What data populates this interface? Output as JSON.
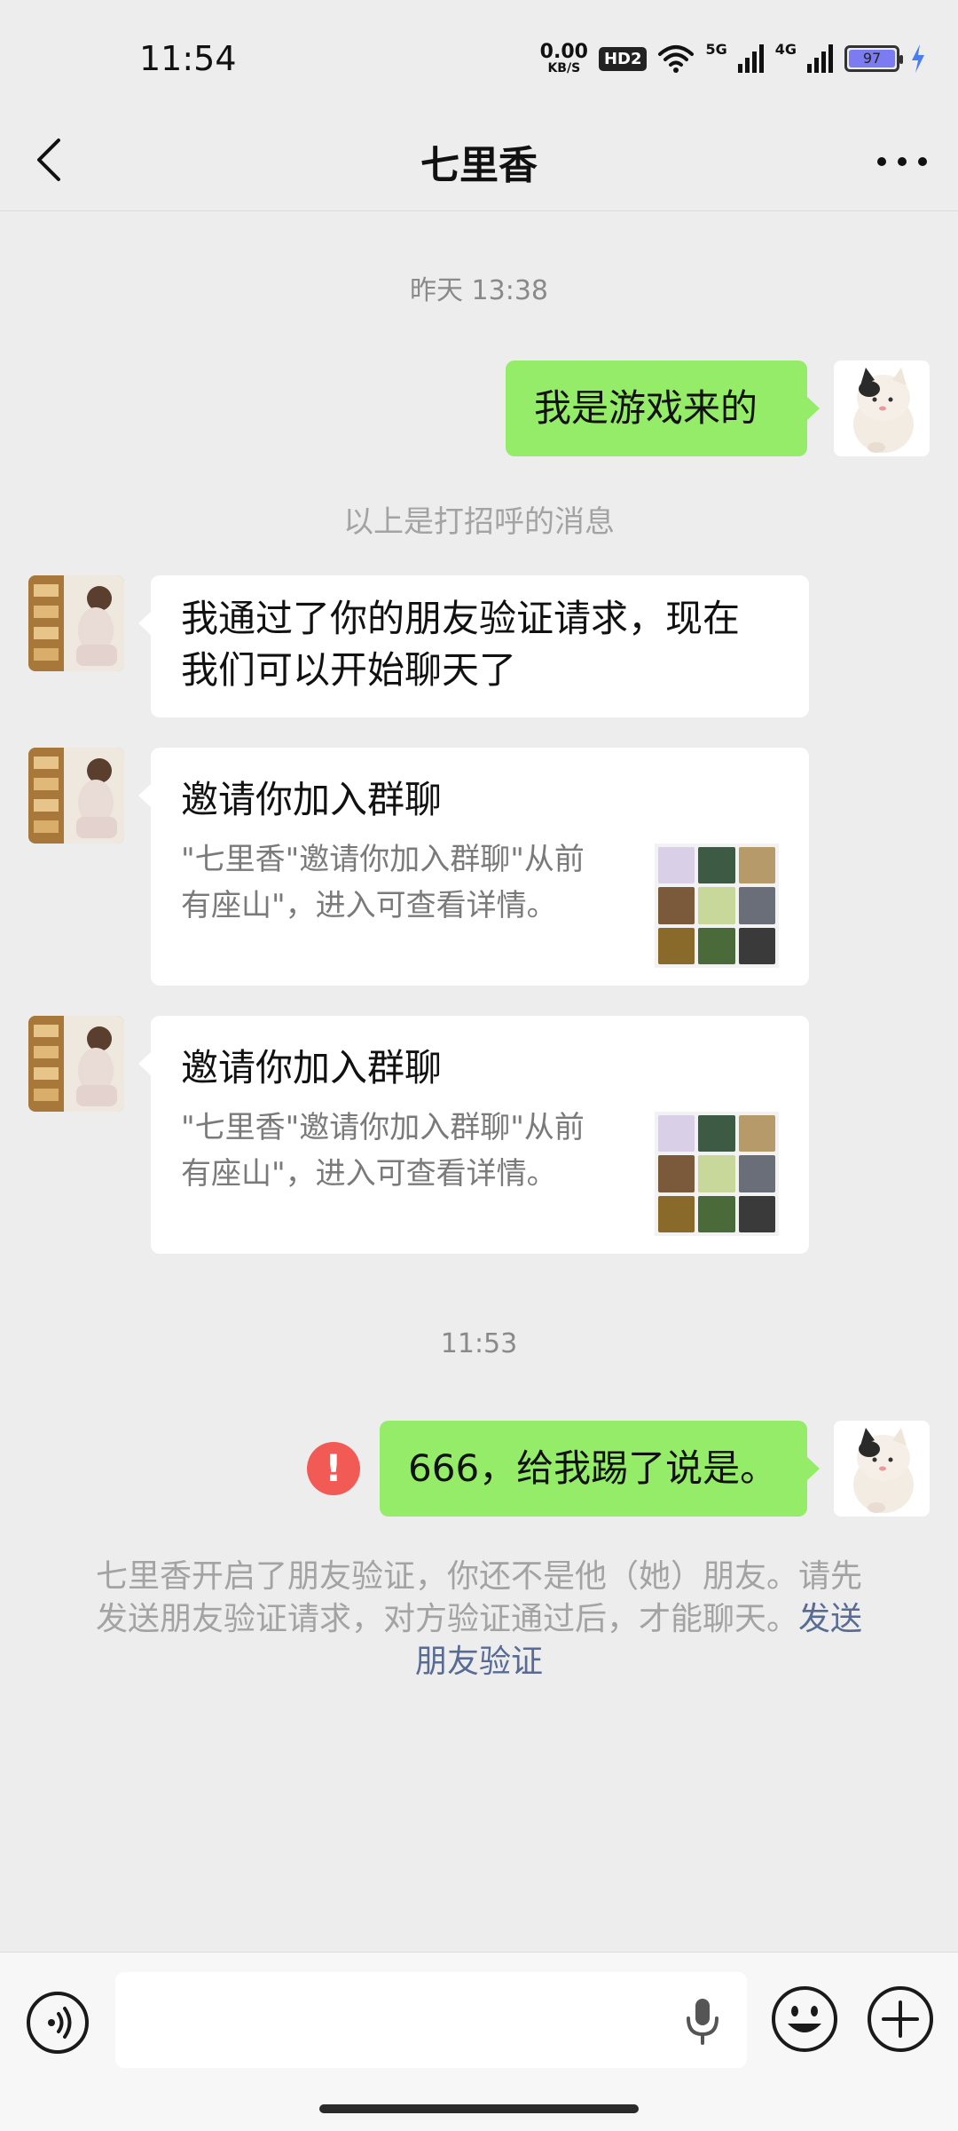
{
  "status_bar": {
    "time": "11:54",
    "net_speed_value": "0.00",
    "net_speed_unit": "KB/S",
    "hd_label": "HD2",
    "signal_1": "5G",
    "signal_2": "4G",
    "battery": "97"
  },
  "header": {
    "title": "七里香",
    "back_icon": "chevron-left-icon",
    "more_icon": "more-dots-icon"
  },
  "chat": {
    "timestamps": [
      "昨天 13:38",
      "11:53"
    ],
    "messages": [
      {
        "side": "out",
        "text": "我是游戏来的"
      },
      {
        "side": "in",
        "text_line1": "我通过了你的朋友验证请求，现在",
        "text_line2": "我们可以开始聊天了"
      },
      {
        "side": "in",
        "type": "group_invite",
        "title": "邀请你加入群聊",
        "desc_line1": "\"七里香\"邀请你加入群聊\"从前",
        "desc_line2": "有座山\"，进入可查看详情。"
      },
      {
        "side": "in",
        "type": "group_invite",
        "title": "邀请你加入群聊",
        "desc_line1": "\"七里香\"邀请你加入群聊\"从前",
        "desc_line2": "有座山\"，进入可查看详情。"
      },
      {
        "side": "out",
        "text": "666，给我踢了说是。",
        "status": "failed"
      }
    ],
    "greeting_note": "以上是打招呼的消息",
    "verify_note": {
      "line1": "七里香开启了朋友验证，你还不是他（她）朋友。请先",
      "line2": "发送朋友验证请求，对方验证通过后，才能聊天。",
      "link": "发送",
      "link_line3": "朋友验证"
    },
    "error_mark": "!"
  },
  "input_bar": {
    "placeholder": "",
    "voice_icon": "voice-icon",
    "mic_icon": "microphone-icon",
    "emoji_icon": "emoji-icon",
    "plus_icon": "plus-icon"
  },
  "colors": {
    "background": "#ededed",
    "outgoing_bubble": "#95ec69",
    "incoming_bubble": "#ffffff",
    "link": "#576b95",
    "error": "#f25b55"
  }
}
